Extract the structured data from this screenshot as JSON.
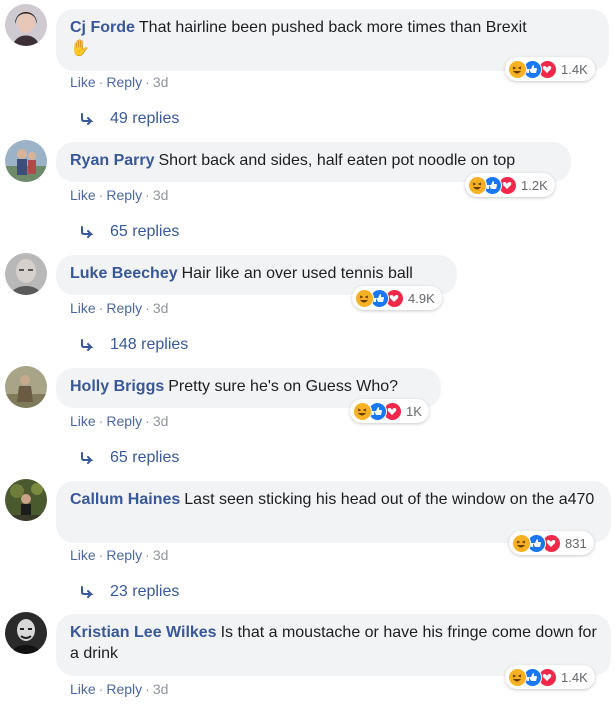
{
  "comments": [
    {
      "author": "Cj Forde",
      "text": "That hairline been pushed back more times than Brexit",
      "emoji": "✋",
      "reaction_count": "1.4K",
      "like_label": "Like",
      "reply_label": "Reply",
      "time": "3d",
      "replies_label": "49 replies"
    },
    {
      "author": "Ryan Parry",
      "text": "Short back and sides, half eaten pot noodle on top",
      "reaction_count": "1.2K",
      "like_label": "Like",
      "reply_label": "Reply",
      "time": "3d",
      "replies_label": "65 replies"
    },
    {
      "author": "Luke Beechey",
      "text": "Hair like an over used tennis ball",
      "reaction_count": "4.9K",
      "like_label": "Like",
      "reply_label": "Reply",
      "time": "3d",
      "replies_label": "148 replies"
    },
    {
      "author": "Holly Briggs",
      "text": "Pretty sure he's on Guess Who?",
      "reaction_count": "1K",
      "like_label": "Like",
      "reply_label": "Reply",
      "time": "3d",
      "replies_label": "65 replies"
    },
    {
      "author": "Callum Haines",
      "text": "Last seen sticking his head out of the window on the a470",
      "reaction_count": "831",
      "like_label": "Like",
      "reply_label": "Reply",
      "time": "3d",
      "replies_label": "23 replies"
    },
    {
      "author": "Kristian Lee Wilkes",
      "text": "Is that a moustache or have his fringe come down for a drink",
      "reaction_count": "1.4K",
      "like_label": "Like",
      "reply_label": "Reply",
      "time": "3d"
    }
  ],
  "reaction_icons": [
    "haha-icon",
    "like-icon",
    "love-icon"
  ],
  "colors": {
    "author": "#385898",
    "bubble": "#f2f3f5",
    "link": "#4b67a1",
    "meta": "#90949c"
  }
}
